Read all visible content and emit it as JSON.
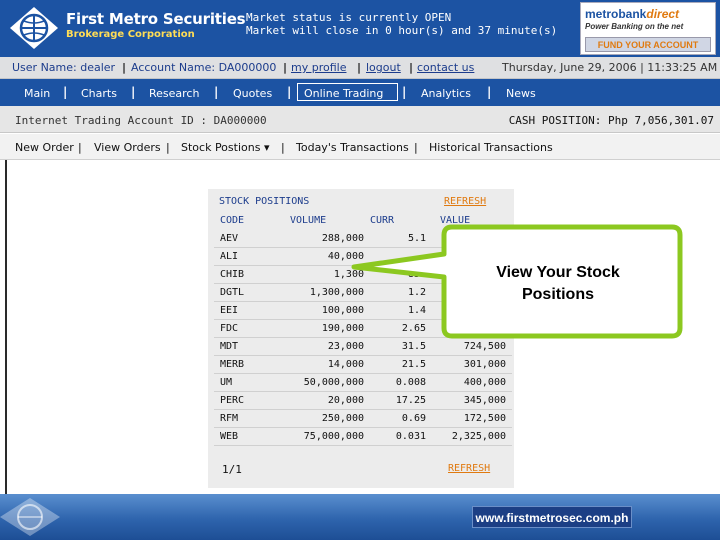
{
  "header": {
    "brand_name": "First Metro Securities",
    "brand_sub": "Brokerage Corporation",
    "market_status_line1": "Market status is currently OPEN",
    "market_status_line2": "Market will close in 0 hour(s) and 37 minute(s)",
    "metrobank_logo_main": "metrobank",
    "metrobank_logo_direct": "direct",
    "metrobank_tagline": "Power Banking on the net",
    "fund_account_label": "FUND YOUR ACCOUNT"
  },
  "userbar": {
    "user_name": "User Name: dealer",
    "account_name": "Account Name: DA000000",
    "my_profile": "my profile",
    "logout": "logout",
    "contact_us": "contact us",
    "datetime": "Thursday, June 29, 2006 | 11:33:25 AM",
    "separator": "|"
  },
  "mainnav": {
    "items": [
      "Main",
      "Charts",
      "Research",
      "Quotes",
      "Online Trading",
      "Analytics",
      "News"
    ],
    "separator": "|"
  },
  "account": {
    "id_label": "Internet Trading Account ID : DA000000",
    "cash_position": "CASH POSITION:  Php 7,056,301.07"
  },
  "subnav": {
    "items": [
      "New Order",
      "View Orders",
      "Stock Postions",
      "Today's Transactions",
      "Historical Transactions"
    ],
    "separator": "|",
    "dropdown_glyph": "▾"
  },
  "positions": {
    "title": "STOCK POSITIONS",
    "refresh": "REFRESH",
    "headers": {
      "code": "CODE",
      "volume": "VOLUME",
      "curr": "CURR",
      "value": "VALUE"
    },
    "rows": [
      {
        "code": "AEV",
        "volume": "288,000",
        "curr": "5.1",
        "value": ""
      },
      {
        "code": "ALI",
        "volume": "40,000",
        "curr": "",
        "value": ""
      },
      {
        "code": "CHIB",
        "volume": "1,300",
        "curr": "855",
        "value": ""
      },
      {
        "code": "DGTL",
        "volume": "1,300,000",
        "curr": "1.2",
        "value": ""
      },
      {
        "code": "EEI",
        "volume": "100,000",
        "curr": "1.4",
        "value": ""
      },
      {
        "code": "FDC",
        "volume": "190,000",
        "curr": "2.65",
        "value": ""
      },
      {
        "code": "MDT",
        "volume": "23,000",
        "curr": "31.5",
        "value": "724,500"
      },
      {
        "code": "MERB",
        "volume": "14,000",
        "curr": "21.5",
        "value": "301,000"
      },
      {
        "code": "UM",
        "volume": "50,000,000",
        "curr": "0.008",
        "value": "400,000"
      },
      {
        "code": "PERC",
        "volume": "20,000",
        "curr": "17.25",
        "value": "345,000"
      },
      {
        "code": "RFM",
        "volume": "250,000",
        "curr": "0.69",
        "value": "172,500"
      },
      {
        "code": "WEB",
        "volume": "75,000,000",
        "curr": "0.031",
        "value": "2,325,000"
      }
    ],
    "page": "1/1"
  },
  "callout": {
    "line1": "View Your Stock",
    "line2": "Positions",
    "border_color": "#8cc820"
  },
  "footer": {
    "url": "www.firstmetrosec.com.ph"
  }
}
